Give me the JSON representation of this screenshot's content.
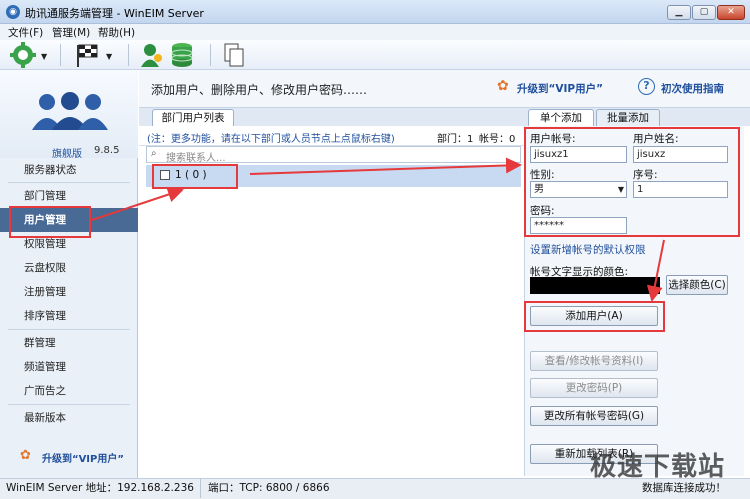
{
  "titlebar": {
    "app_icon": "chat-bubble-icon",
    "title": "助讯通服务端管理 - WinEIM Server",
    "min_icon": "minimize-icon",
    "max_icon": "maximize-icon",
    "close_icon": "close-icon"
  },
  "menu": {
    "file": "文件(F)",
    "manage": "管理(M)",
    "help": "帮助(H)"
  },
  "toolbar": {
    "icons": [
      "gear-icon",
      "checkered-flag-icon",
      "user-gear-icon",
      "database-icon",
      "documents-icon"
    ]
  },
  "sidebar": {
    "edition": "旗舰版",
    "version": "9.8.5",
    "items": [
      "服务器状态",
      "部门管理",
      "用户管理",
      "权限管理",
      "云盘权限",
      "注册管理",
      "排序管理",
      "群管理",
      "频道管理",
      "广而告之",
      "最新版本"
    ],
    "vip": "升级到“VIP用户”"
  },
  "header": {
    "description": "添加用户、删除用户、修改用户密码……",
    "vip_link": "升级到“VIP用户”",
    "guide_link": "初次使用指南"
  },
  "list_panel": {
    "tab": "部门用户列表",
    "note": "(注：更多功能，请在以下部门或人员节点上点鼠标右键)",
    "dept_label": "部门：1",
    "account_label": "帐号：0",
    "search_placeholder": "搜索联系人...",
    "tree_node": "1 ( 0 )"
  },
  "form": {
    "tab_single": "单个添加",
    "tab_batch": "批量添加",
    "account_label": "用户帐号:",
    "account_value": "jisuxz1",
    "name_label": "用户姓名:",
    "name_value": "jisuxz",
    "gender_label": "性别:",
    "gender_value": "男",
    "order_label": "序号:",
    "order_value": "1",
    "password_label": "密码:",
    "password_value": "******",
    "default_perm_link": "设置新增帐号的默认权限",
    "color_label": "帐号文字显示的颜色:",
    "color_value": "#000000",
    "choose_color": "选择颜色(C)",
    "add_user": "添加用户(A)",
    "view_edit": "查看/修改帐号资料(I)",
    "change_pwd": "更改密码(P)",
    "change_all_pwd": "更改所有帐号密码(G)",
    "reload_list": "重新加载列表(R)"
  },
  "status": {
    "server_address": "WinEIM Server 地址：192.168.2.236",
    "port": "端口：TCP: 6800 / 6866",
    "db_status": "数据库连接成功！"
  },
  "watermark": "极速下载站",
  "colors": {
    "accent": "#486a94",
    "highlight": "#e5393b",
    "link": "#1f4f9c"
  }
}
